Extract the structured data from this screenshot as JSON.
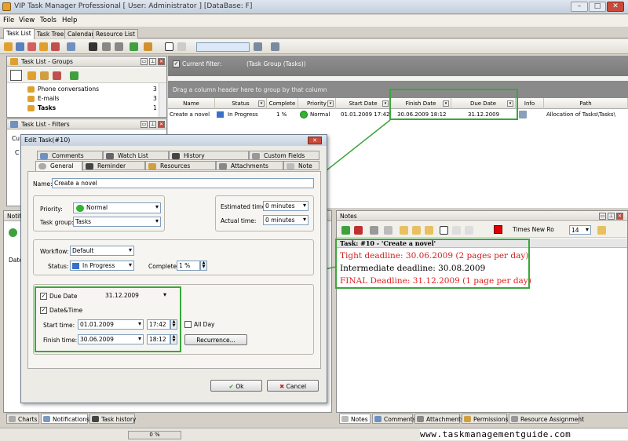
{
  "window": {
    "title": "VIP Task Manager Professional [ User: Administrator ] [DataBase: F]"
  },
  "menu": [
    "File",
    "View",
    "Tools",
    "Help"
  ],
  "main_tabs": [
    "Task List",
    "Task Tree",
    "Calendar",
    "Resource List"
  ],
  "groups_pane": {
    "title": "Task List - Groups",
    "items": [
      {
        "label": "Phone conversations",
        "count": "3"
      },
      {
        "label": "E-mails",
        "count": "3"
      },
      {
        "label": "Tasks",
        "count": "1"
      }
    ]
  },
  "filters_pane": {
    "title": "Task List - Filters",
    "cut_text": "Cu",
    "cut_text2": "C"
  },
  "notifications_pane": {
    "title": "Notifi",
    "cut_text": "Date"
  },
  "filter_bar": {
    "label": "Current filter:",
    "value": "(Task Group  (Tasks))"
  },
  "group_hint": "Drag a column header here to group by that column",
  "grid": {
    "columns": [
      "Name",
      "Status",
      "Complete",
      "Priority",
      "Start Date",
      "Finish Date",
      "Due Date",
      "Info",
      "Path"
    ],
    "rows": [
      {
        "name": "Create a novel",
        "status": "In Progress",
        "complete": "1 %",
        "priority": "Normal",
        "start": "01.01.2009 17:42",
        "finish": "30.06.2009 18:12",
        "due": "31.12.2009",
        "info": "",
        "path": "Allocation of Tasks\\Tasks\\"
      }
    ]
  },
  "dialog": {
    "title": "Edit Task(#10)",
    "tabs_row1": [
      "Comments",
      "Watch List",
      "History",
      "Custom Fields"
    ],
    "tabs_row2": [
      "General",
      "Reminder",
      "Resources",
      "Attachments",
      "Note"
    ],
    "name_label": "Name:",
    "name_value": "Create a novel",
    "priority_label": "Priority:",
    "priority_value": "Normal",
    "group_label": "Task group:",
    "group_value": "Tasks",
    "est_label": "Estimated time:",
    "est_value": "0 minutes",
    "actual_label": "Actual time:",
    "actual_value": "0 minutes",
    "workflow_label": "Workflow:",
    "workflow_value": "Default",
    "status_label": "Status:",
    "status_value": "In Progress",
    "complete_label": "Complete:",
    "complete_value": "1 %",
    "due_label": "Due Date",
    "due_value": "31.12.2009",
    "datetime_label": "Date&Time",
    "start_label": "Start time:",
    "start_date": "01.01.2009",
    "start_time": "17:42",
    "allday_label": "All Day",
    "finish_label": "Finish time:",
    "finish_date": "30.06.2009",
    "finish_time": "18:12",
    "recurrence_label": "Recurrence...",
    "ok_label": "Ok",
    "cancel_label": "Cancel"
  },
  "notes": {
    "title": "Notes",
    "font_name": "Times New Ro",
    "font_size": "14",
    "task_header": "Task: #10 - 'Create a novel'",
    "lines": [
      {
        "text": "Tight deadline: 30.06.2009 (2 pages per day)",
        "color": "#cc2020"
      },
      {
        "text": "Intermediate deadline: 30.08.2009",
        "color": "#000000"
      },
      {
        "text": "FINAL Deadline: 31.12.2009 (1 page per day)",
        "color": "#e02020"
      }
    ]
  },
  "bottom_tabs_left": [
    "Charts",
    "Notifications",
    "Task history"
  ],
  "bottom_tabs_right": [
    "Notes",
    "Comments",
    "Attachments",
    "Permissions",
    "Resource Assignment"
  ],
  "status_bar": {
    "progress": "0 %"
  },
  "watermark": "www.taskmanagementguide.com",
  "colors": {
    "highlight": "#3aa63a",
    "priority_green": "#2fb52f",
    "close_red": "#c94a3a"
  }
}
